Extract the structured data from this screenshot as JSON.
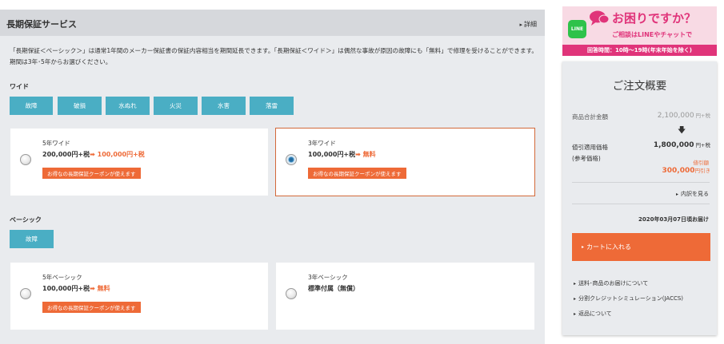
{
  "warranty": {
    "title": "長期保証サービス",
    "detail_link": "詳細",
    "description": "「長期保証＜ベーシック＞」は通常1年間のメーカー保証書の保証内容相当を期間延長できます。「長期保証＜ワイド＞」は偶然な事故が原因の故障にも「無料」で修理を受けることができます。期間は3年･5年からお選びください。",
    "wide": {
      "label": "ワイド",
      "chips": [
        "故障",
        "破損",
        "水ぬれ",
        "火災",
        "水害",
        "落雷"
      ],
      "options": [
        {
          "name": "5年ワイド",
          "price_before": "200,000円+税",
          "arrow": "➡",
          "price_after": "100,000円+税",
          "coupon": "お得なの長期保証クーポンが使えます",
          "checked": false
        },
        {
          "name": "3年ワイド",
          "price_before": "100,000円+税",
          "arrow": "➡",
          "price_after": "無料",
          "coupon": "お得なの長期保証クーポンが使えます",
          "checked": true
        }
      ]
    },
    "basic": {
      "label": "ベーシック",
      "chips": [
        "故障"
      ],
      "options": [
        {
          "name": "5年ベーシック",
          "price_before": "100,000円+税",
          "arrow": "➡",
          "price_after": "無料",
          "coupon": "お得なの長期保証クーポンが使えます",
          "checked": false
        },
        {
          "name": "3年ベーシック",
          "price_before": "標準付属（無償）",
          "checked": false
        }
      ]
    }
  },
  "banner": {
    "line_label": "LINE",
    "main": "お困りですか？",
    "sub": "ご相談はLINEやチャットで",
    "hours": "回答時間：10時～19時(年末年始を除く)"
  },
  "summary": {
    "title": "ご注文概要",
    "subtotal_label": "商品合計金額",
    "subtotal_value": "2,100,000",
    "subtotal_unit": "円+税",
    "down_arrow": "🡇",
    "discounted_label": "値引適用価格\n(参考価格)",
    "discounted_value": "1,800,000",
    "discounted_unit": "円+税",
    "discount_label": "値引額",
    "discount_value": "300,000",
    "discount_unit": "円引き",
    "breakdown": "内訳を見る",
    "delivery": "2020年03月07日頃お届け",
    "cart_button": "カートに入れる",
    "links": [
      "送料･商品のお届けについて",
      "分割クレジットシミュレーション(JACCS)",
      "返品について"
    ]
  },
  "colors": {
    "accent_orange": "#ee6a37",
    "chip_blue": "#4aaec4",
    "line_green": "#2fc24a",
    "banner_pink": "#e0347a"
  }
}
